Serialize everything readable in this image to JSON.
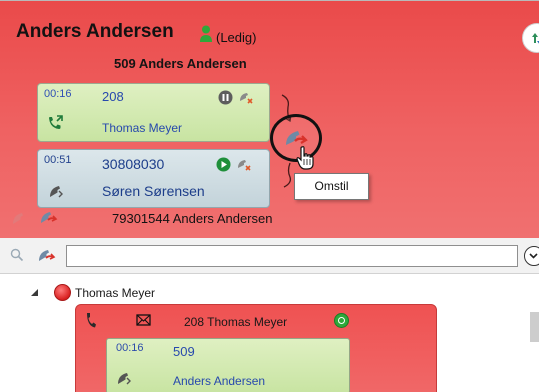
{
  "user": {
    "name": "Anders Andersen",
    "status": "(Ledig)",
    "extension_line": "509 Anders Andersen"
  },
  "calls": [
    {
      "time": "00:16",
      "number": "208",
      "name": "Thomas Meyer",
      "state": "active"
    },
    {
      "time": "00:51",
      "number": "30808030",
      "name": "Søren Sørensen",
      "state": "on-hold"
    }
  ],
  "tooltip": {
    "label": "Omstil"
  },
  "pending_call": {
    "text": "79301544 Anders Andersen"
  },
  "search": {
    "value": "",
    "placeholder": ""
  },
  "tree": {
    "group_name": "Thomas Meyer",
    "contact": {
      "extension_line": "208 Thomas Meyer",
      "call": {
        "time": "00:16",
        "number": "509",
        "name": "Anders Andersen"
      }
    }
  },
  "colors": {
    "busy_red": "#ea4a4a",
    "active_call_green": "#dff0c2",
    "hold_call_gray": "#dce7eb",
    "call_text_blue": "#2749ad",
    "available_green": "#2fa83a"
  }
}
